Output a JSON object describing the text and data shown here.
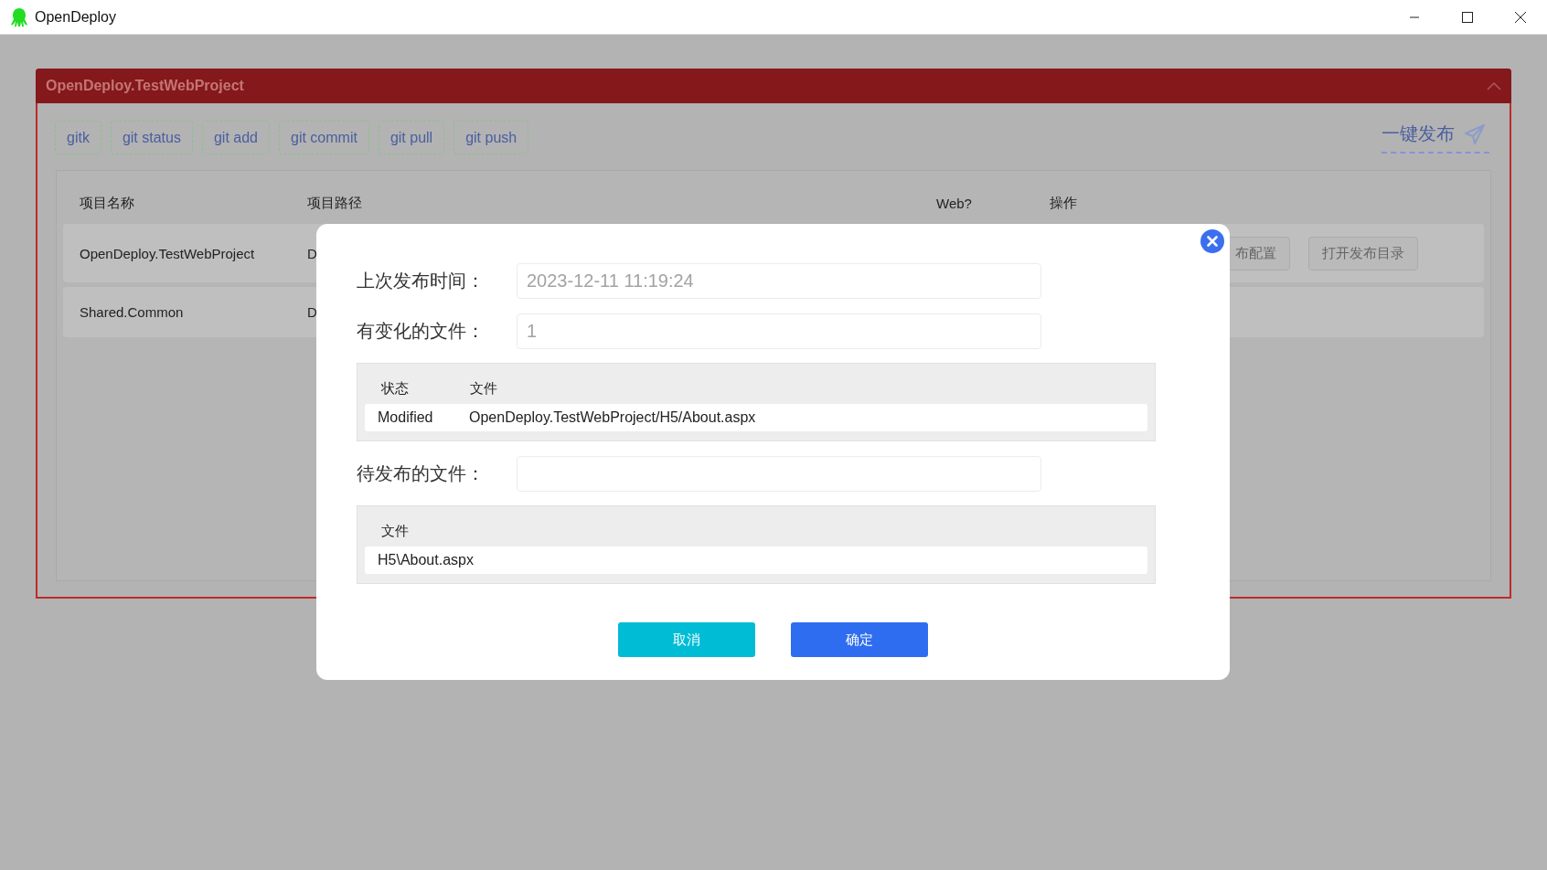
{
  "window": {
    "title": "OpenDeploy"
  },
  "project_panel": {
    "title": "OpenDeploy.TestWebProject",
    "git_buttons": [
      "gitk",
      "git status",
      "git add",
      "git commit",
      "git pull",
      "git push"
    ],
    "publish_button": "一键发布",
    "table": {
      "columns": [
        "项目名称",
        "项目路径",
        "Web?",
        "操作"
      ],
      "rows": [
        {
          "name": "OpenDeploy.TestWebProject",
          "path": "D",
          "actions": [
            "布配置",
            "打开发布目录"
          ]
        },
        {
          "name": "Shared.Common",
          "path": "D"
        }
      ]
    }
  },
  "dialog": {
    "sections": [
      {
        "kind": "field",
        "label": "上次发布时间：",
        "value": "2023-12-11 11:19:24"
      },
      {
        "kind": "field",
        "label": "有变化的文件：",
        "value": "1"
      },
      {
        "kind": "table",
        "columns": [
          "状态",
          "文件"
        ],
        "rows": [
          [
            "Modified",
            "OpenDeploy.TestWebProject/H5/About.aspx"
          ]
        ]
      },
      {
        "kind": "field",
        "label": "待发布的文件："
      },
      {
        "kind": "table",
        "columns": [
          "文件"
        ],
        "rows": [
          [
            "H5\\About.aspx"
          ]
        ]
      }
    ],
    "buttons": [
      {
        "label": "取消",
        "kind": "cancel"
      },
      {
        "label": "确定",
        "kind": "confirm"
      }
    ]
  }
}
